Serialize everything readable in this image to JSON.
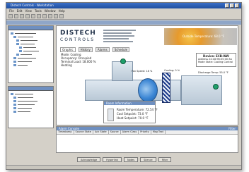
{
  "app": {
    "title": "Distech Controls - Workstation"
  },
  "menu": [
    "File",
    "Edit",
    "View",
    "Tools",
    "Window",
    "Help"
  ],
  "brand": {
    "line1": "DISTECH",
    "line2": "CONTROLS"
  },
  "banner": {
    "text": "Outside Temperature: 68.0 °F"
  },
  "tabs": [
    "Graphic",
    "History",
    "Alarms",
    "Schedule"
  ],
  "status": {
    "mode": "Mode: Cooling",
    "occupancy": "Occupancy: Occupied",
    "terminal_load": "Terminal Load: 18.000 %",
    "heating": "Heating"
  },
  "device": {
    "title": "Device: ECB-VAV",
    "address": "Address 24:18:96:05:00:3A",
    "state": "Mode State: Cooling Control"
  },
  "labels": {
    "fan": "Fan Speed: 18 %",
    "coil": "Cooling: 0 %",
    "discharge": "Discharge Temp: 55.0 °F"
  },
  "room_info": {
    "title": "Room Information",
    "room_temp": "Room Temperature: 72.54 °F",
    "cool_setpoint": "Cool Setpoint: 73.0 °F",
    "heat_setpoint": "Heat Setpoint: 70.0 °F"
  },
  "alarm": {
    "title": "Alarm Console",
    "right": "Filter",
    "columns": [
      "Timestamp",
      "Source State",
      "Ack State",
      "Source",
      "Alarm Class",
      "Priority",
      "Msg Text"
    ]
  },
  "buttons": [
    "Acknowledge",
    "Hyperlink",
    "Notes",
    "Silence",
    "Filter"
  ]
}
